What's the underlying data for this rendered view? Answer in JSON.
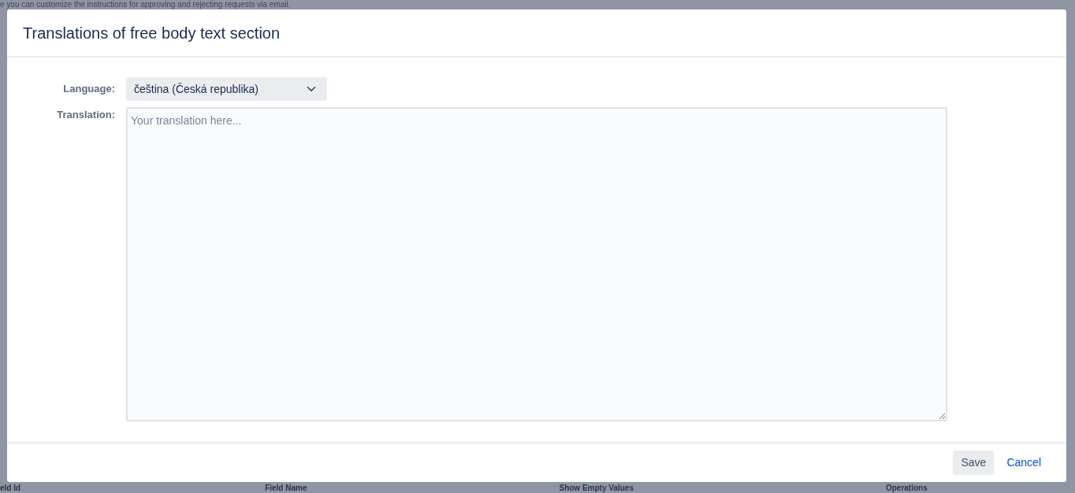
{
  "background_page": {
    "intro_text": "e you can customize the instructions for approving and rejecting requests via email.",
    "table": {
      "columns": [
        "eld Id",
        "Field Name",
        "Show Empty Values",
        "Operations"
      ]
    }
  },
  "dialog": {
    "title": "Translations of free body text section",
    "language": {
      "label": "Language:",
      "value": "čeština (Česká republika)"
    },
    "translation": {
      "label": "Translation:",
      "placeholder": "Your translation here..."
    },
    "buttons": [
      {
        "label": "Save",
        "kind": "secondary"
      },
      {
        "label": "Cancel",
        "kind": "link"
      }
    ]
  }
}
